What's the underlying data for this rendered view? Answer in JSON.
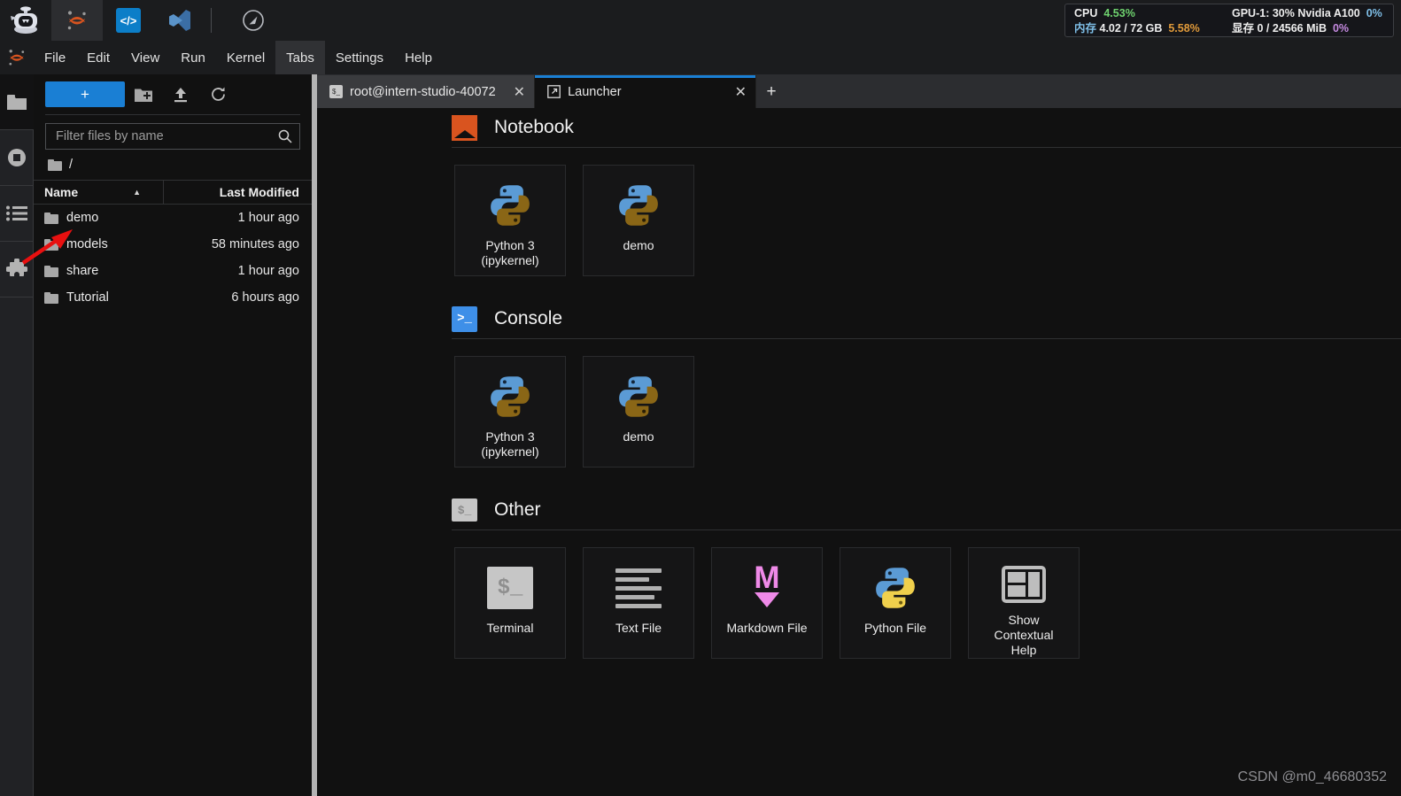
{
  "system_bar": {
    "icons": [
      "robot-logo-icon",
      "jupyter-logo-icon",
      "code-server-icon",
      "vscode-icon",
      "compass-icon"
    ],
    "monitor": {
      "cpu_label": "CPU",
      "cpu_value": "4.53%",
      "gpu_label": "GPU-1: 30% Nvidia A100",
      "gpu_value": "0%",
      "mem_label": "内存",
      "mem_value": "4.02 / 72 GB",
      "mem_pct": "5.58%",
      "vram_label": "显存",
      "vram_value": "0 / 24566 MiB",
      "vram_pct": "0%",
      "colors": {
        "green": "#6fd36f",
        "orange": "#e09a3a",
        "purple": "#c58ae0",
        "blue": "#7fbfe8"
      }
    }
  },
  "menubar": {
    "items": [
      {
        "label": "File",
        "selected": false
      },
      {
        "label": "Edit",
        "selected": false
      },
      {
        "label": "View",
        "selected": false
      },
      {
        "label": "Run",
        "selected": false
      },
      {
        "label": "Kernel",
        "selected": false
      },
      {
        "label": "Tabs",
        "selected": true
      },
      {
        "label": "Settings",
        "selected": false
      },
      {
        "label": "Help",
        "selected": false
      }
    ]
  },
  "activity_bar": {
    "items": [
      {
        "name": "file-browser",
        "icon": "folder-icon",
        "active": true
      },
      {
        "name": "running-terminals",
        "icon": "stop-circle-icon",
        "active": false
      },
      {
        "name": "table-of-contents",
        "icon": "list-icon",
        "active": false
      },
      {
        "name": "extension-manager",
        "icon": "puzzle-icon",
        "active": false
      }
    ]
  },
  "file_browser": {
    "new_launcher_label": "+",
    "toolbar_icons": [
      "new-folder-icon",
      "upload-icon",
      "refresh-icon"
    ],
    "filter_placeholder": "Filter files by name",
    "filter_value": "",
    "breadcrumb": "/",
    "columns": {
      "name": "Name",
      "last_modified": "Last Modified"
    },
    "sort_indicator": "▲",
    "rows": [
      {
        "name": "demo",
        "modified": "1 hour ago"
      },
      {
        "name": "models",
        "modified": "58 minutes ago"
      },
      {
        "name": "share",
        "modified": "1 hour ago"
      },
      {
        "name": "Tutorial",
        "modified": "6 hours ago"
      }
    ]
  },
  "tabbar": {
    "tabs": [
      {
        "label": "root@intern-studio-40072",
        "icon": "terminal-icon",
        "active": false,
        "close": "✕"
      },
      {
        "label": "Launcher",
        "icon": "launcher-icon",
        "active": true,
        "close": "✕"
      }
    ],
    "new_tab_label": "+",
    "accent_color": "#1a7fd4"
  },
  "launcher": {
    "sections": [
      {
        "title": "Notebook",
        "icon": "notebook-bookmark-icon",
        "cards": [
          {
            "label": "Python 3\n(ipykernel)",
            "label_line1": "Python 3",
            "label_line2": "(ipykernel)",
            "icon": "python-kernel-icon"
          },
          {
            "label": "demo",
            "label_line1": "demo",
            "label_line2": "",
            "icon": "python-kernel-icon"
          }
        ]
      },
      {
        "title": "Console",
        "icon": "console-prompt-icon",
        "cards": [
          {
            "label": "Python 3\n(ipykernel)",
            "label_line1": "Python 3",
            "label_line2": "(ipykernel)",
            "icon": "python-kernel-icon"
          },
          {
            "label": "demo",
            "label_line1": "demo",
            "label_line2": "",
            "icon": "python-kernel-icon"
          }
        ]
      },
      {
        "title": "Other",
        "icon": "terminal-dollar-icon",
        "cards": [
          {
            "label": "Terminal",
            "label_line1": "Terminal",
            "label_line2": "",
            "label_line3": "",
            "icon": "terminal-dollar-icon"
          },
          {
            "label": "Text File",
            "label_line1": "Text File",
            "label_line2": "",
            "label_line3": "",
            "icon": "text-file-icon"
          },
          {
            "label": "Markdown File",
            "label_line1": "Markdown File",
            "label_line2": "",
            "label_line3": "",
            "icon": "markdown-file-icon"
          },
          {
            "label": "Python File",
            "label_line1": "Python File",
            "label_line2": "",
            "label_line3": "",
            "icon": "python-file-icon"
          },
          {
            "label": "Show Contextual Help",
            "label_line1": "Show",
            "label_line2": "Contextual",
            "label_line3": "Help",
            "icon": "contextual-help-icon"
          }
        ]
      }
    ]
  },
  "watermark": "CSDN @m0_46680352",
  "annotation": {
    "type": "red-arrow",
    "color": "#e81010",
    "points_to": "demo"
  }
}
